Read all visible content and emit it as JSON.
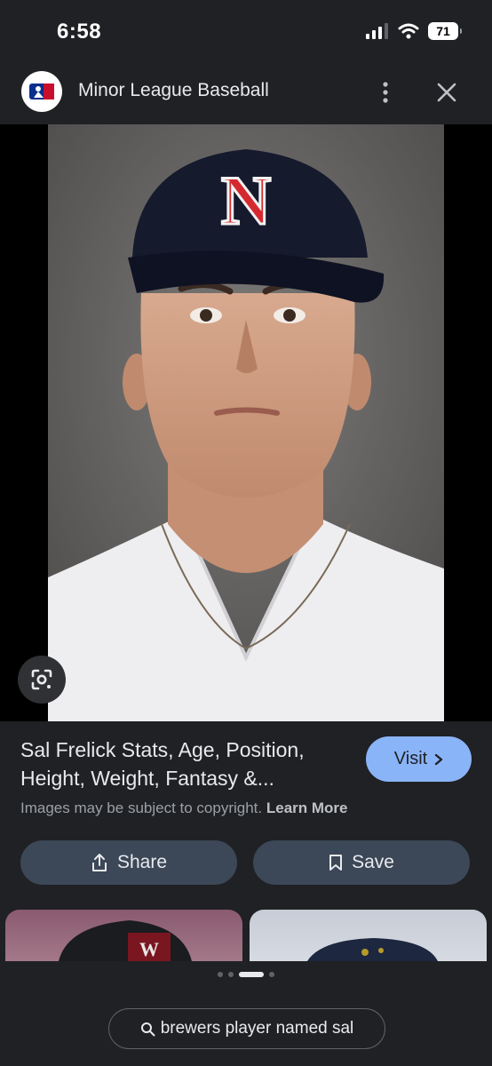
{
  "status_bar": {
    "time": "6:58",
    "battery": "71"
  },
  "header": {
    "source_name": "Minor League Baseball"
  },
  "result": {
    "title": "Sal Frelick Stats, Age, Position, Height, Weight, Fantasy &...",
    "visit_label": "Visit",
    "copyright_text": "Images may be subject to copyright.",
    "learn_more_label": "Learn More"
  },
  "actions": {
    "share_label": "Share",
    "save_label": "Save"
  },
  "search": {
    "query": "brewers player named sal"
  },
  "pager": {
    "count": 4,
    "active_index": 2
  },
  "colors": {
    "background": "#202124",
    "accent": "#8ab4f8",
    "action_button": "#3c4757",
    "cap_logo": "#d42a2f"
  }
}
